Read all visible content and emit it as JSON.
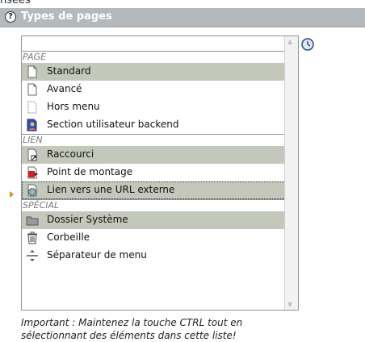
{
  "top_fragment": "nsées",
  "panel": {
    "title": "Types de pages"
  },
  "listbox": {
    "groups": [
      {
        "label": "PAGE",
        "items": [
          {
            "label": "Standard",
            "icon": "document-icon",
            "selected": true
          },
          {
            "label": "Avancé",
            "icon": "document-icon",
            "selected": false
          },
          {
            "label": "Hors menu",
            "icon": "dotted-document-icon",
            "selected": false
          },
          {
            "label": "Section utilisateur backend",
            "icon": "backend-user-icon",
            "selected": false
          }
        ]
      },
      {
        "label": "LIEN",
        "items": [
          {
            "label": "Raccourci",
            "icon": "shortcut-document-icon",
            "selected": true
          },
          {
            "label": "Point de montage",
            "icon": "mountpoint-icon",
            "selected": false
          },
          {
            "label": "Lien vers une URL externe",
            "icon": "globe-link-icon",
            "selected": true,
            "focused": true
          }
        ]
      },
      {
        "label": "SPÉCIAL",
        "items": [
          {
            "label": "Dossier Système",
            "icon": "folder-icon",
            "selected": true
          },
          {
            "label": "Corbeille",
            "icon": "trash-icon",
            "selected": false
          },
          {
            "label": "Séparateur de menu",
            "icon": "menu-separator-icon",
            "selected": false
          }
        ]
      }
    ]
  },
  "note": "Important : Maintenez la touche CTRL tout en sélectionnant des éléments dans cette liste!",
  "colors": {
    "titlebar": "#b4b9bd",
    "selected_row": "#c4c8ba",
    "group_label": "#7a7a7a",
    "marker": "#d98a1c"
  }
}
